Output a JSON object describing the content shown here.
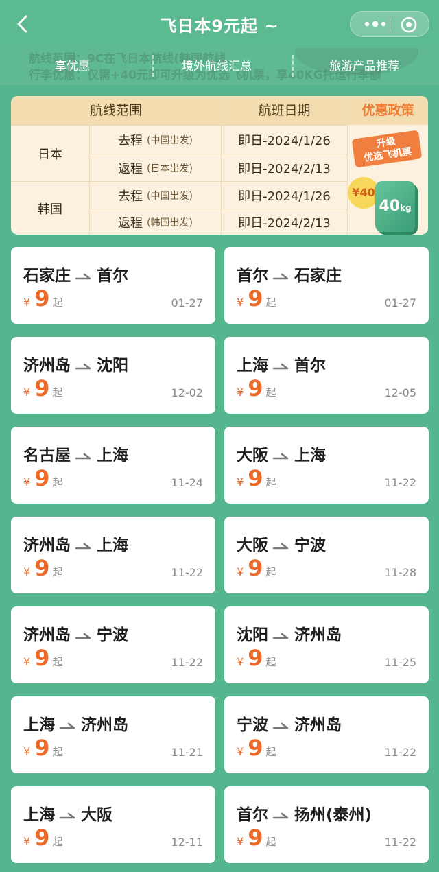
{
  "header": {
    "title": "飞日本9元起 ~"
  },
  "nav": {
    "ghost_line1": "航线范围：9C在飞日本航线(韩国航线",
    "ghost_line2": "行李优惠：仅需+40元即可升级为优选飞机票，享40KG托运行李额",
    "tabs": [
      {
        "label": "享优惠"
      },
      {
        "label": "境外航线汇总"
      },
      {
        "label": "旅游产品推荐"
      }
    ]
  },
  "policy": {
    "headers": [
      "航线范围",
      "航班日期",
      "优惠政策"
    ],
    "accent": "#ee7c32",
    "groups": [
      {
        "country": "日本",
        "rows": [
          {
            "dir": "去程",
            "note": "(中国出发)",
            "date": "即日-2024/1/26"
          },
          {
            "dir": "返程",
            "note": "(日本出发)",
            "date": "即日-2024/2/13"
          }
        ]
      },
      {
        "country": "韩国",
        "rows": [
          {
            "dir": "去程",
            "note": "(中国出发)",
            "date": "即日-2024/1/26"
          },
          {
            "dir": "返程",
            "note": "(韩国出发)",
            "date": "即日-2024/2/13"
          }
        ]
      }
    ],
    "promo": {
      "tag_line1": "升级",
      "tag_line2": "优选飞机票",
      "coin": "¥40",
      "bag_weight": "40",
      "bag_unit": "kg"
    }
  },
  "route_cards": [
    {
      "from": "石家庄",
      "to": "首尔",
      "currency": "¥",
      "price": "9",
      "suffix": "起",
      "date": "01-27"
    },
    {
      "from": "首尔",
      "to": "石家庄",
      "currency": "¥",
      "price": "9",
      "suffix": "起",
      "date": "01-27"
    },
    {
      "from": "济州岛",
      "to": "沈阳",
      "currency": "¥",
      "price": "9",
      "suffix": "起",
      "date": "12-02"
    },
    {
      "from": "上海",
      "to": "首尔",
      "currency": "¥",
      "price": "9",
      "suffix": "起",
      "date": "12-05"
    },
    {
      "from": "名古屋",
      "to": "上海",
      "currency": "¥",
      "price": "9",
      "suffix": "起",
      "date": "11-24"
    },
    {
      "from": "大阪",
      "to": "上海",
      "currency": "¥",
      "price": "9",
      "suffix": "起",
      "date": "11-22"
    },
    {
      "from": "济州岛",
      "to": "上海",
      "currency": "¥",
      "price": "9",
      "suffix": "起",
      "date": "11-22"
    },
    {
      "from": "大阪",
      "to": "宁波",
      "currency": "¥",
      "price": "9",
      "suffix": "起",
      "date": "11-28"
    },
    {
      "from": "济州岛",
      "to": "宁波",
      "currency": "¥",
      "price": "9",
      "suffix": "起",
      "date": "11-22"
    },
    {
      "from": "沈阳",
      "to": "济州岛",
      "currency": "¥",
      "price": "9",
      "suffix": "起",
      "date": "11-25"
    },
    {
      "from": "上海",
      "to": "济州岛",
      "currency": "¥",
      "price": "9",
      "suffix": "起",
      "date": "11-21"
    },
    {
      "from": "宁波",
      "to": "济州岛",
      "currency": "¥",
      "price": "9",
      "suffix": "起",
      "date": "11-22"
    },
    {
      "from": "上海",
      "to": "大阪",
      "currency": "¥",
      "price": "9",
      "suffix": "起",
      "date": "12-11"
    },
    {
      "from": "首尔",
      "to": "扬州(泰州)",
      "currency": "¥",
      "price": "9",
      "suffix": "起",
      "date": "11-22"
    }
  ],
  "colors": {
    "background": "#54b58e",
    "price": "#ed6a28",
    "header_bg": "#f3dcaf"
  }
}
